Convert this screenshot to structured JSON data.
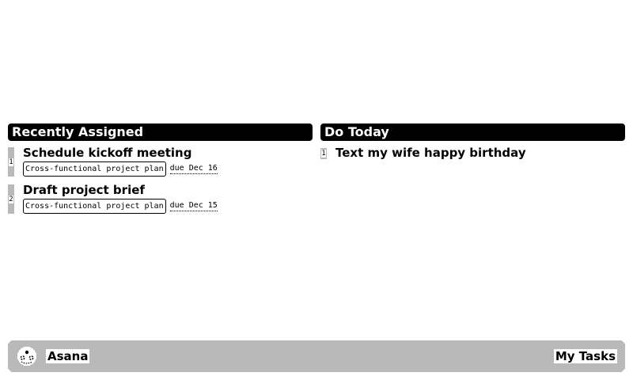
{
  "columns": {
    "recent": {
      "title": "Recently Assigned",
      "tasks": [
        {
          "index": "1",
          "title": "Schedule kickoff meeting",
          "project": "Cross-functional project plan",
          "due": "due Dec 16"
        },
        {
          "index": "2",
          "title": "Draft project brief",
          "project": "Cross-functional project plan",
          "due": "due Dec 15"
        }
      ]
    },
    "today": {
      "title": "Do Today",
      "tasks": [
        {
          "index": "1",
          "title": "Text my wife happy birthday"
        }
      ]
    }
  },
  "footer": {
    "app_name": "Asana",
    "app_icon": "asana-logo-icon",
    "view_label": "My Tasks"
  }
}
